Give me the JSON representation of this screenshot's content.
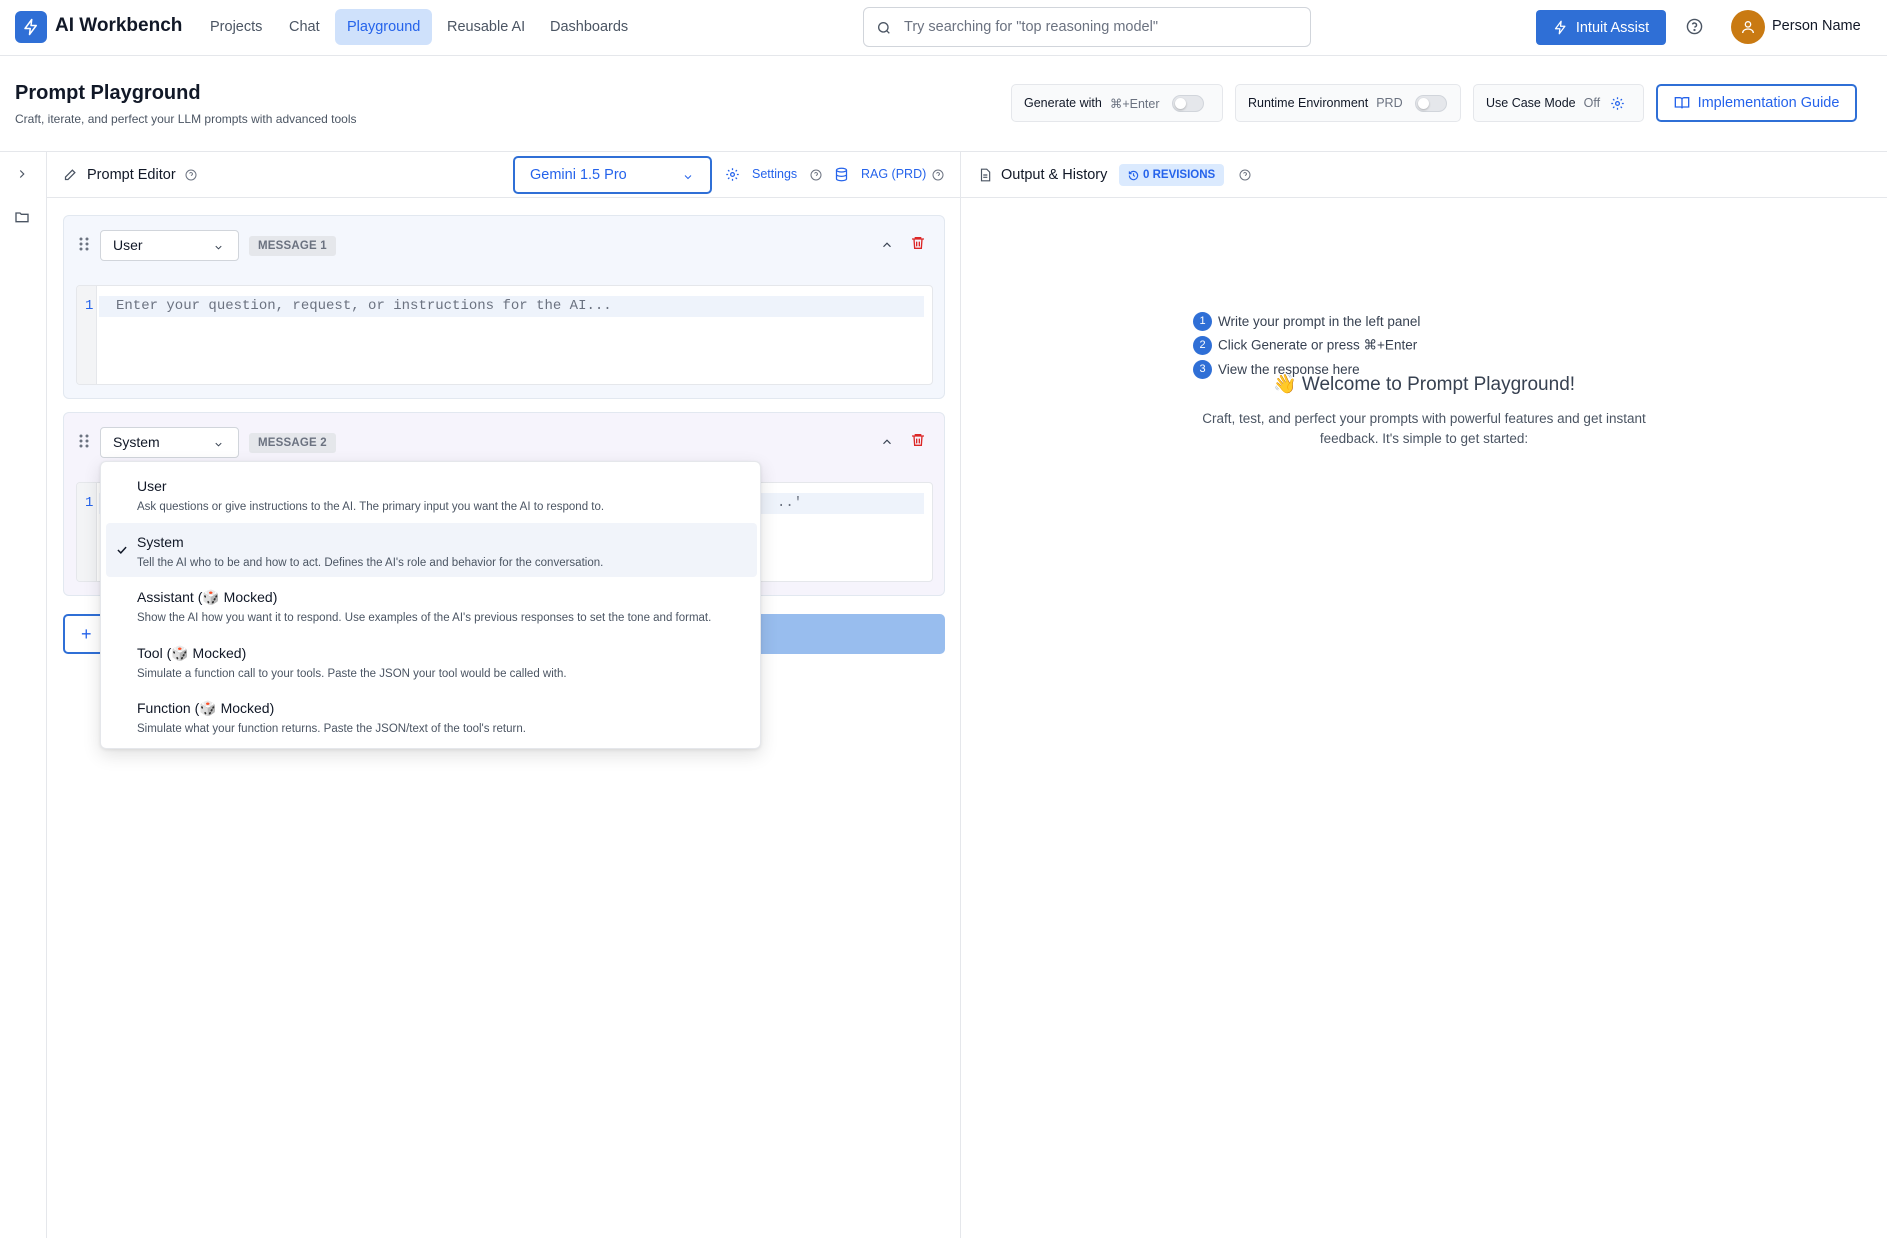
{
  "app": {
    "title": "AI Workbench"
  },
  "nav": {
    "items": [
      {
        "label": "Projects"
      },
      {
        "label": "Chat"
      },
      {
        "label": "Playground"
      },
      {
        "label": "Reusable AI"
      },
      {
        "label": "Dashboards"
      }
    ]
  },
  "search": {
    "placeholder": "Try searching for \"top reasoning model\""
  },
  "header": {
    "assist_label": "Intuit Assist",
    "user_name": "Person Name"
  },
  "page": {
    "title": "Prompt Playground",
    "subtitle": "Craft, iterate, and perfect your LLM prompts with advanced tools",
    "generate": {
      "label": "Generate with",
      "shortcut": "⌘+Enter"
    },
    "runtime": {
      "label": "Runtime Environment",
      "value": "PRD"
    },
    "usecase": {
      "label": "Use Case Mode",
      "value": "Off"
    },
    "impl_label": "Implementation Guide"
  },
  "editor": {
    "title": "Prompt Editor",
    "model": "Gemini 1.5 Pro",
    "settings_label": "Settings",
    "rag_label": "RAG (PRD)",
    "messages": [
      {
        "role": "User",
        "badge": "MESSAGE 1",
        "line_number": "1",
        "placeholder": "Enter your question, request, or instructions for the AI..."
      },
      {
        "role": "System",
        "badge": "MESSAGE 2",
        "line_number": "1",
        "placeholder_tail": "..'"
      }
    ],
    "add_symbol": "+"
  },
  "dropdown": {
    "options": [
      {
        "name": "User",
        "desc": "Ask questions or give instructions to the AI. The primary input you want the AI to respond to.",
        "selected": false
      },
      {
        "name": "System",
        "desc": "Tell the AI who to be and how to act. Defines the AI's role and behavior for the conversation.",
        "selected": true
      },
      {
        "name": "Assistant (🎲 Mocked)",
        "desc": "Show the AI how you want it to respond. Use examples of the AI's previous responses to set the tone and format.",
        "selected": false
      },
      {
        "name": "Tool (🎲 Mocked)",
        "desc": "Simulate a function call to your tools. Paste the JSON your tool would be called with.",
        "selected": false
      },
      {
        "name": "Function (🎲 Mocked)",
        "desc": "Simulate what your function returns. Paste the JSON/text of the tool's return.",
        "selected": false
      }
    ]
  },
  "output": {
    "title": "Output & History",
    "revisions": "0 REVISIONS",
    "welcome_title": "👋 Welcome to Prompt Playground!",
    "welcome_desc": "Craft, test, and perfect your prompts with powerful features and get instant feedback. It's simple to get started:",
    "steps": [
      {
        "num": "1",
        "text": "Write your prompt in the left panel"
      },
      {
        "num": "2",
        "text": "Click Generate or press ⌘+Enter"
      },
      {
        "num": "3",
        "text": "View the response here"
      }
    ]
  },
  "colors": {
    "accent": "#2f6fd6",
    "danger": "#dc2626",
    "avatar": "#c97a12"
  }
}
